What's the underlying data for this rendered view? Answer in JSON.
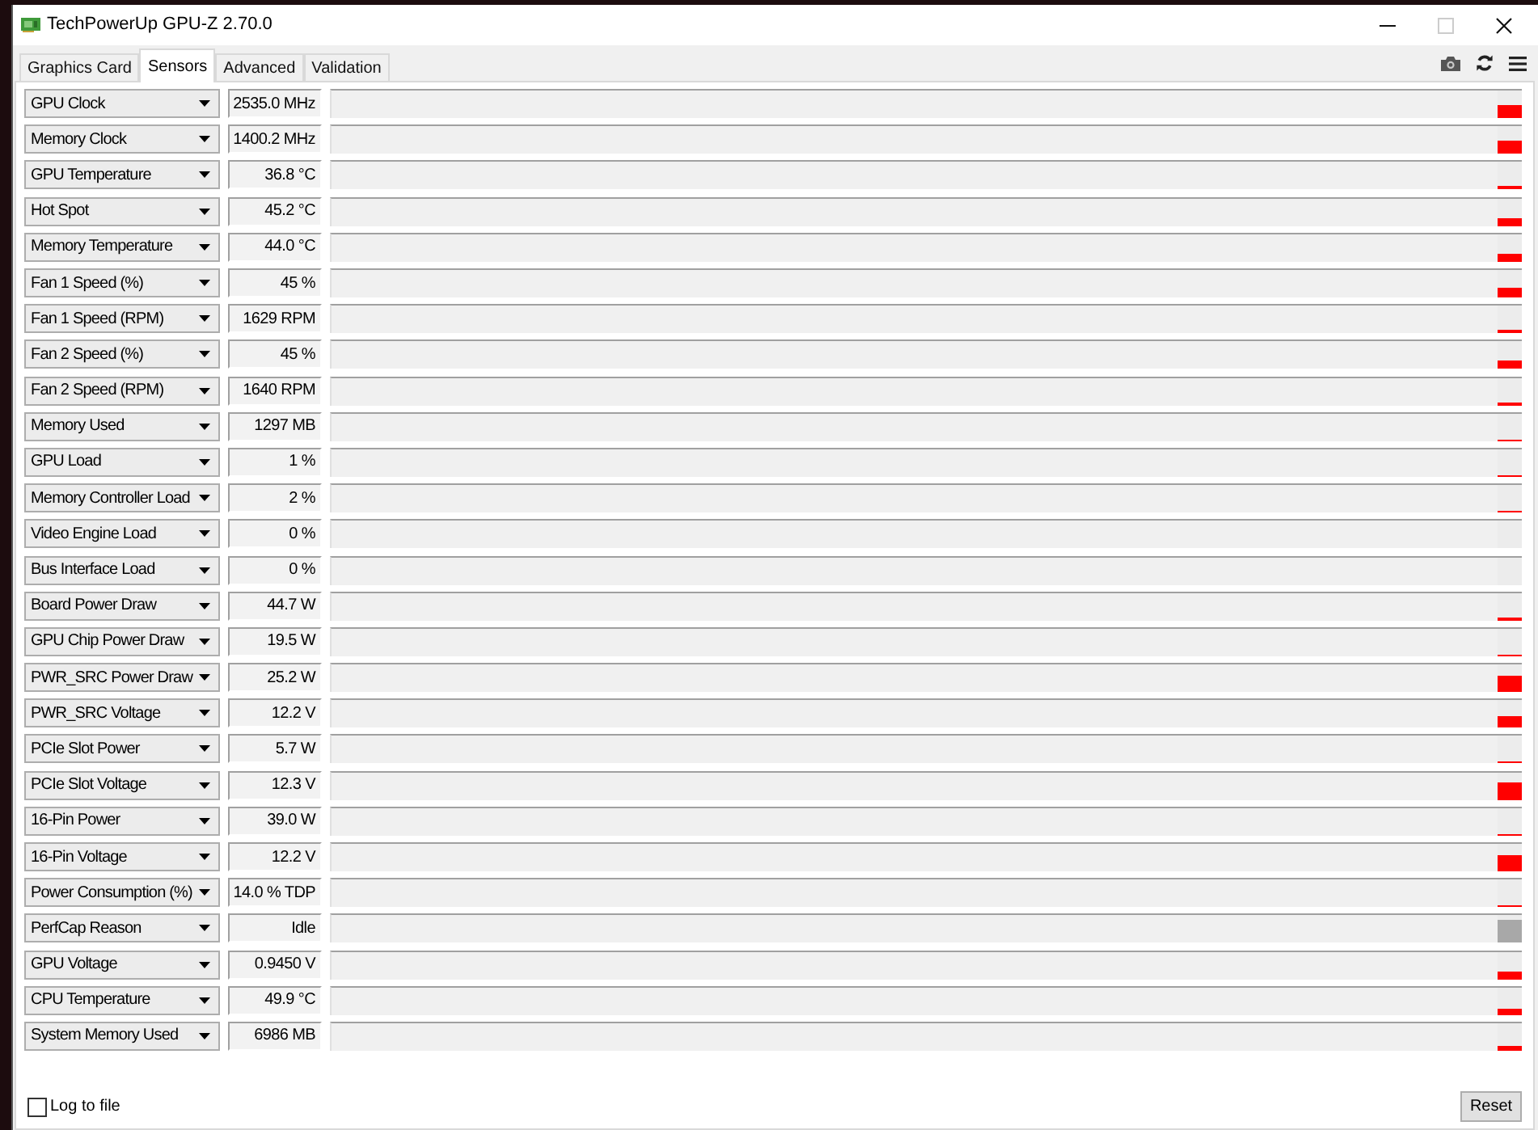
{
  "window": {
    "title": "TechPowerUp GPU-Z 2.70.0",
    "controls": [
      {
        "kind": "minimize",
        "disabled": false
      },
      {
        "kind": "maximize",
        "disabled": true
      },
      {
        "kind": "close",
        "disabled": false
      }
    ]
  },
  "tabs": [
    {
      "label": "Graphics Card",
      "selected": false
    },
    {
      "label": "Sensors",
      "selected": true
    },
    {
      "label": "Advanced",
      "selected": false
    },
    {
      "label": "Validation",
      "selected": false
    }
  ],
  "sensors": [
    {
      "name": "GPU Clock",
      "value": "2535.0 MHz",
      "level": 0.5,
      "color": "#ff0000"
    },
    {
      "name": "Memory Clock",
      "value": "1400.2 MHz",
      "level": 0.5,
      "color": "#ff0000"
    },
    {
      "name": "GPU Temperature",
      "value": "36.8 °C",
      "level": 0.12,
      "color": "#ff0000"
    },
    {
      "name": "Hot Spot",
      "value": "45.2 °C",
      "level": 0.28,
      "color": "#ff0000"
    },
    {
      "name": "Memory Temperature",
      "value": "44.0 °C",
      "level": 0.28,
      "color": "#ff0000"
    },
    {
      "name": "Fan 1 Speed (%)",
      "value": "45 %",
      "level": 0.33,
      "color": "#ff0000"
    },
    {
      "name": "Fan 1 Speed (RPM)",
      "value": "1629 RPM",
      "level": 0.12,
      "color": "#ff0000"
    },
    {
      "name": "Fan 2 Speed (%)",
      "value": "45 %",
      "level": 0.33,
      "color": "#ff0000"
    },
    {
      "name": "Fan 2 Speed (RPM)",
      "value": "1640 RPM",
      "level": 0.12,
      "color": "#ff0000"
    },
    {
      "name": "Memory Used",
      "value": "1297 MB",
      "level": 0.06,
      "color": "#ff0000"
    },
    {
      "name": "GPU Load",
      "value": "1 %",
      "level": 0.04,
      "color": "#ff0000"
    },
    {
      "name": "Memory Controller Load",
      "value": "2 %",
      "level": 0.03,
      "color": "#ff0000"
    },
    {
      "name": "Video Engine Load",
      "value": "0 %",
      "level": 0
    },
    {
      "name": "Bus Interface Load",
      "value": "0 %",
      "level": 0
    },
    {
      "name": "Board Power Draw",
      "value": "44.7 W",
      "level": 0.1,
      "color": "#ff0000"
    },
    {
      "name": "GPU Chip Power Draw",
      "value": "19.5 W",
      "level": 0.06,
      "color": "#ff0000"
    },
    {
      "name": "PWR_SRC Power Draw",
      "value": "25.2 W",
      "level": 0.6,
      "color": "#ff0000"
    },
    {
      "name": "PWR_SRC Voltage",
      "value": "12.2 V",
      "level": 0.45,
      "color": "#ff0000"
    },
    {
      "name": "PCIe Slot Power",
      "value": "5.7 W",
      "level": 0.06,
      "color": "#ff0000"
    },
    {
      "name": "PCIe Slot Voltage",
      "value": "12.3 V",
      "level": 0.6,
      "color": "#ff0000"
    },
    {
      "name": "16-Pin Power",
      "value": "39.0 W",
      "level": 0.06,
      "color": "#ff0000"
    },
    {
      "name": "16-Pin Voltage",
      "value": "12.2 V",
      "level": 0.6,
      "color": "#ff0000"
    },
    {
      "name": "Power Consumption (%)",
      "value": "14.0 % TDP",
      "level": 0.08,
      "color": "#ff0000"
    },
    {
      "name": "PerfCap Reason",
      "value": "Idle",
      "level": 0.85,
      "color": "#a8a8a8"
    },
    {
      "name": "GPU Voltage",
      "value": "0.9450 V",
      "level": 0.3,
      "color": "#ff0000"
    },
    {
      "name": "CPU Temperature",
      "value": "49.9 °C",
      "level": 0.25,
      "color": "#ff0000"
    },
    {
      "name": "System Memory Used",
      "value": "6986 MB",
      "level": 0.2,
      "color": "#ff0000"
    }
  ],
  "log_to_file": {
    "label": "Log to file",
    "checked": false
  },
  "reset_button": {
    "label": "Reset"
  }
}
